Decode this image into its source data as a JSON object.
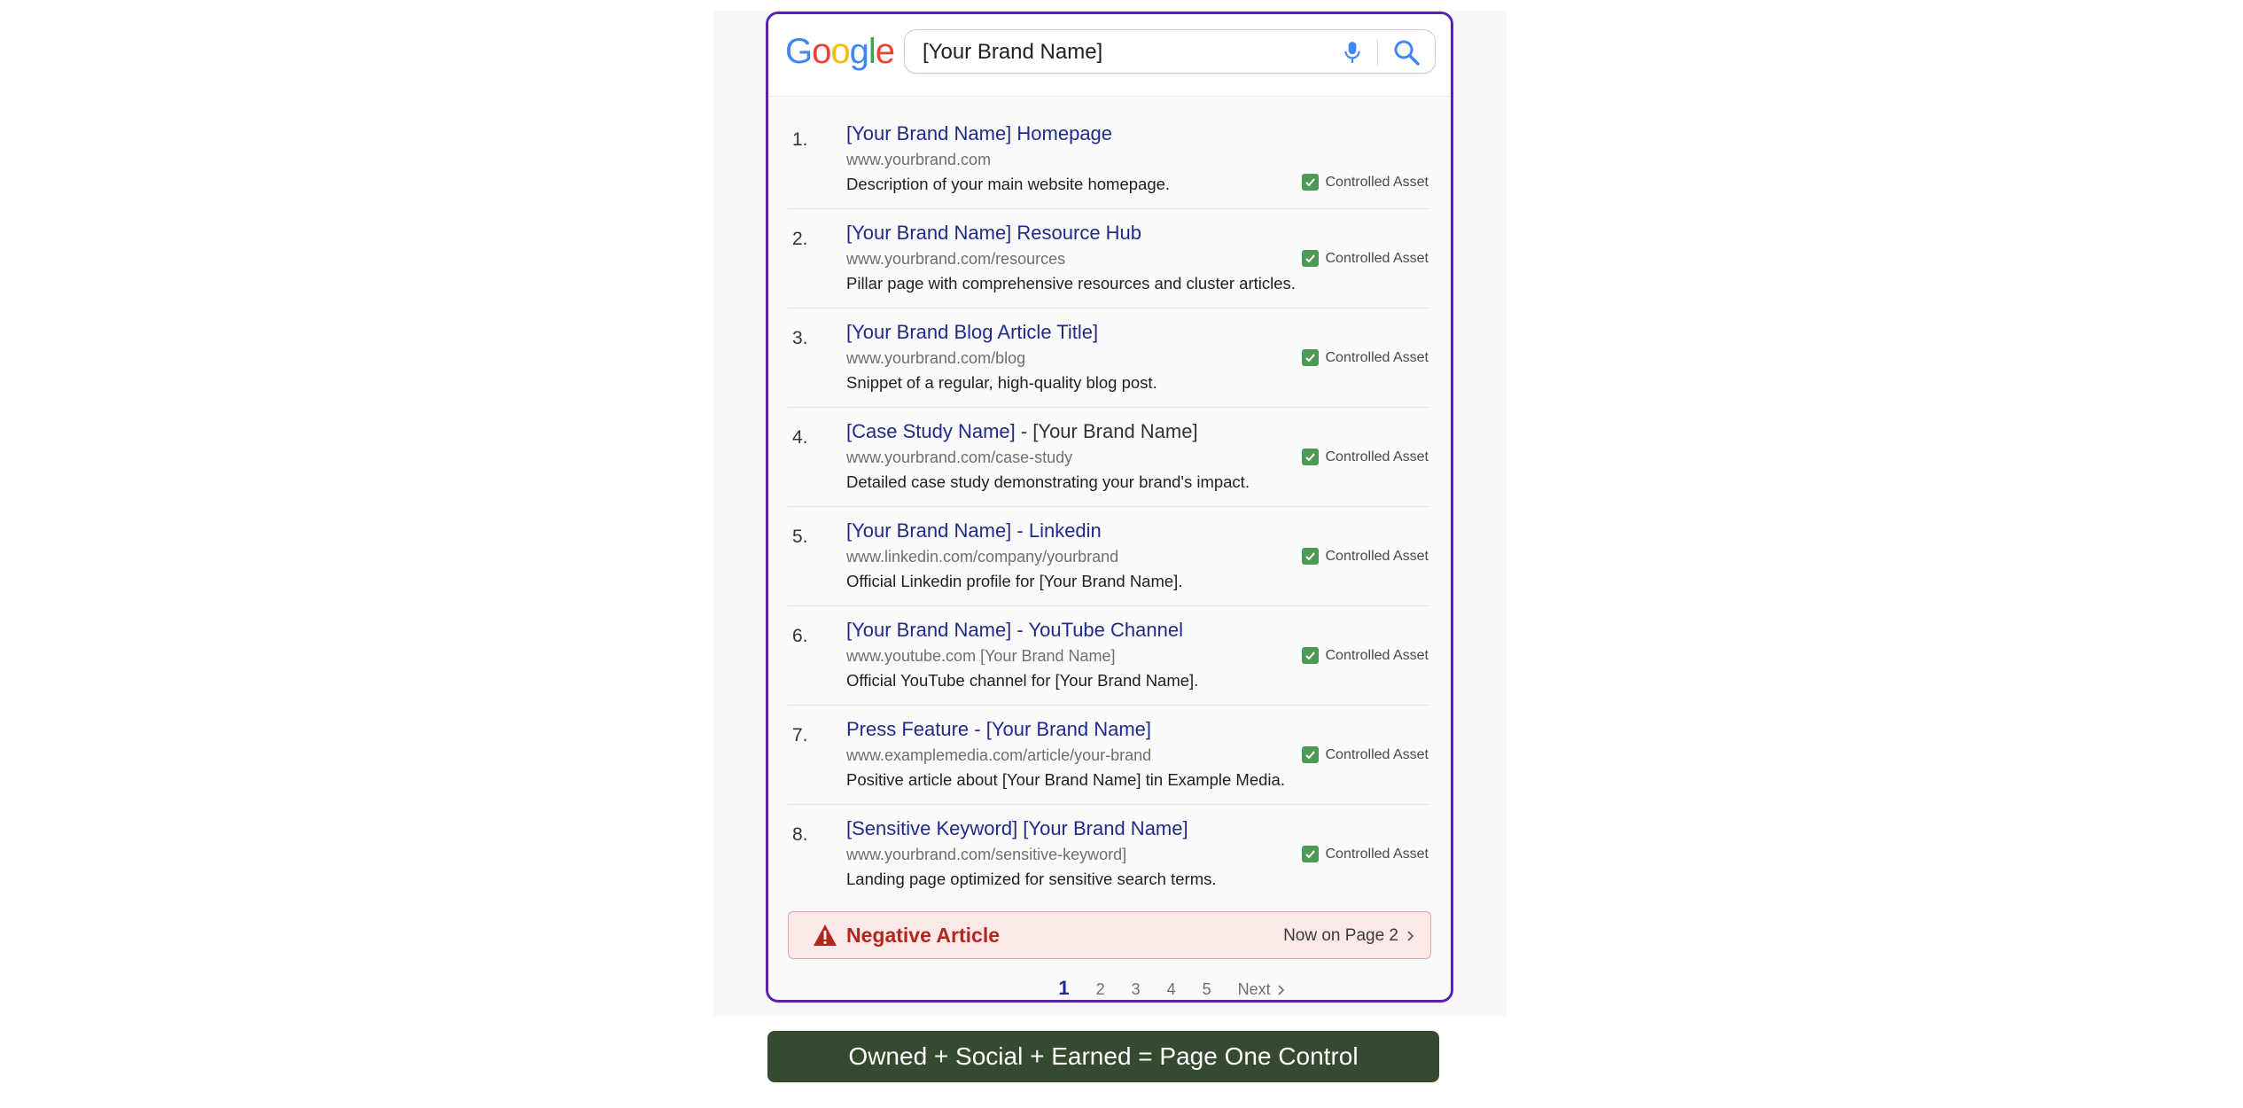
{
  "header": {
    "logo_letters": [
      "G",
      "o",
      "o",
      "g",
      "l",
      "e"
    ],
    "logo_colors": [
      "#4285F4",
      "#EA4335",
      "#FBBC05",
      "#4285F4",
      "#34A853",
      "#EA4335"
    ],
    "search_value": "[Your Brand Name]"
  },
  "badge_label": "Controlled Asset",
  "results": [
    {
      "num": "1.",
      "title": "[Your Brand Name] Homepage",
      "title_suffix": "",
      "url": "www.yourbrand.com",
      "desc": "Description of your main website homepage."
    },
    {
      "num": "2.",
      "title": "[Your Brand Name] Resource Hub",
      "title_suffix": "",
      "url": "www.yourbrand.com/resources",
      "desc": "Pillar page with comprehensive resources  and  cluster articles."
    },
    {
      "num": "3.",
      "title": "[Your Brand Blog Article Title]",
      "title_suffix": "",
      "url": "www.yourbrand.com/blog",
      "desc": "Snippet of a regular, high-quality blog post."
    },
    {
      "num": "4.",
      "title": "[Case Study Name]",
      "title_suffix": " - [Your Brand Name]",
      "url": "www.yourbrand.com/case-study",
      "desc": "Detailed case study demonstrating your brand's impact."
    },
    {
      "num": "5.",
      "title": "[Your Brand Name] - Linkedin",
      "title_suffix": "",
      "url": "www.linkedin.com/company/yourbrand",
      "desc": "Official Linkedin profile for [Your Brand Name]."
    },
    {
      "num": "6.",
      "title": "[Your Brand Name] - YouTube Channel",
      "title_suffix": "",
      "url": "www.youtube.com [Your Brand Name]",
      "desc": "Official YouTube channel for [Your  Brand  Name]."
    },
    {
      "num": "7.",
      "title": "Press Feature - [Your Brand Name]",
      "title_suffix": "",
      "url": "www.examplemedia.com/article/your-brand",
      "desc": "Positive article about [Your Brand Name] tin  Example Media."
    },
    {
      "num": "8.",
      "title": "[Sensitive Keyword]  [Your Brand Name]",
      "title_suffix": "",
      "url": "www.yourbrand.com/sensitive-keyword]",
      "desc": "Landing page optimized for sensitive search terms."
    }
  ],
  "negative": {
    "label": "Negative Article",
    "page_text": "Now on Page 2"
  },
  "pagination": {
    "current": "1",
    "pages": [
      "2",
      "3",
      "4",
      "5"
    ],
    "next_label": "Next"
  },
  "footer": {
    "banner_text": "Owned + Social + Earned = Page One Control"
  },
  "colors": {
    "card_border": "#5b21b6",
    "title_link": "#1f2a8c",
    "check_green": "#4c9a56",
    "negative_red": "#b3261e",
    "banner_green": "#354a2e"
  }
}
